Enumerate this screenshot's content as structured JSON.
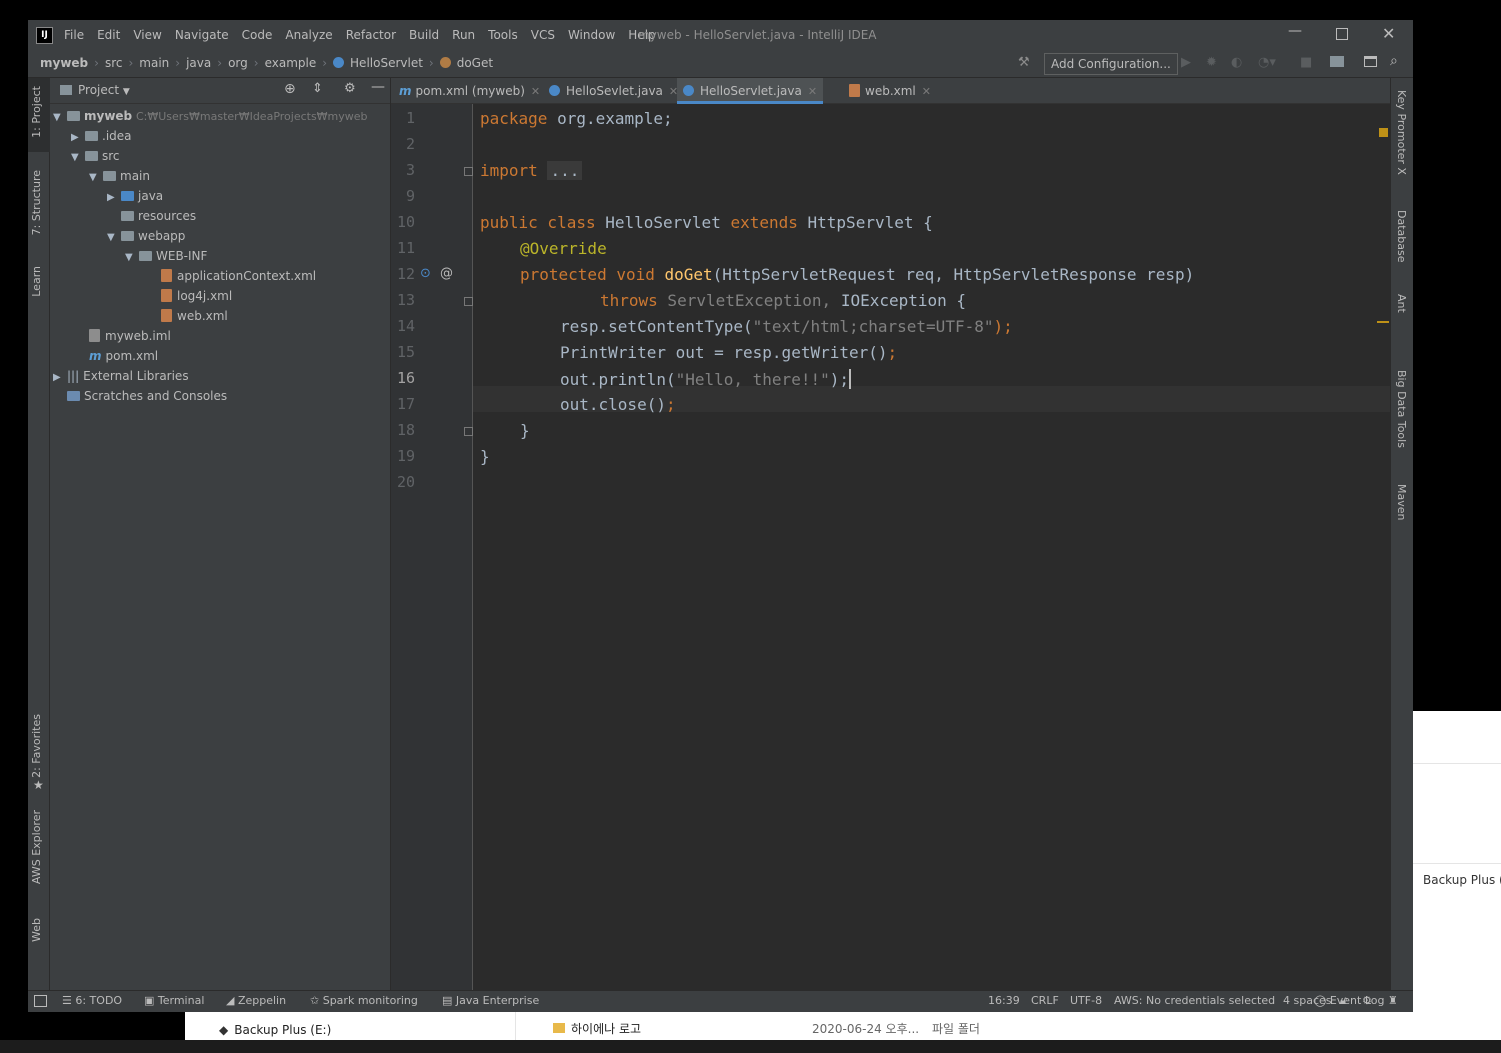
{
  "window": {
    "title": "myweb - HelloServlet.java - IntelliJ IDEA",
    "menu": [
      "File",
      "Edit",
      "View",
      "Navigate",
      "Code",
      "Analyze",
      "Refactor",
      "Build",
      "Run",
      "Tools",
      "VCS",
      "Window",
      "Help"
    ]
  },
  "breadcrumbs": [
    "myweb",
    "src",
    "main",
    "java",
    "org",
    "example",
    "HelloServlet",
    "doGet"
  ],
  "toolbar": {
    "add_configuration": "Add Configuration..."
  },
  "left_strip": {
    "project": "1: Project",
    "structure": "7: Structure",
    "learn": "Learn",
    "favorites": "2: Favorites",
    "aws": "AWS Explorer",
    "web": "Web"
  },
  "right_strip": {
    "key_promoter": "Key Promoter X",
    "database": "Database",
    "ant": "Ant",
    "big_data": "Big Data Tools",
    "maven": "Maven"
  },
  "project": {
    "header": "Project",
    "tree": [
      {
        "label": "myweb",
        "extra": "C:₩Users₩master₩IdeaProjects₩myweb"
      },
      {
        "label": ".idea"
      },
      {
        "label": "src"
      },
      {
        "label": "main"
      },
      {
        "label": "java"
      },
      {
        "label": "resources"
      },
      {
        "label": "webapp"
      },
      {
        "label": "WEB-INF"
      },
      {
        "label": "applicationContext.xml"
      },
      {
        "label": "log4j.xml"
      },
      {
        "label": "web.xml"
      },
      {
        "label": "myweb.iml"
      },
      {
        "label": "pom.xml"
      },
      {
        "label": "External Libraries"
      },
      {
        "label": "Scratches and Consoles"
      }
    ]
  },
  "tabs": [
    {
      "label": "pom.xml (myweb)"
    },
    {
      "label": "HelloSevlet.java"
    },
    {
      "label": "HelloServlet.java"
    },
    {
      "label": "web.xml"
    }
  ],
  "line_numbers": [
    "1",
    "2",
    "3",
    "9",
    "10",
    "11",
    "12",
    "13",
    "14",
    "15",
    "16",
    "17",
    "18",
    "19",
    "20"
  ],
  "code": {
    "l1a": "package",
    "l1b": " org.example;",
    "l3a": "import",
    "l3b": "...",
    "l10a": "public class",
    "l10b": " HelloServlet ",
    "l10c": "extends",
    "l10d": " HttpServlet {",
    "l11": "@Override",
    "l12a": "protected void",
    "l12b": "doGet",
    "l12c": "(HttpServletRequest req, HttpServletResponse resp)",
    "l13a": "throws",
    "l13b": " ServletException,",
    "l13c": " IOException {",
    "l14a": "resp.setContentType(",
    "l14b": "\"text/html;charset=UTF-8\"",
    "l14c": ");",
    "l15a": "PrintWriter out = resp.getWriter()",
    "l15b": ";",
    "l16a": "out.println(",
    "l16b": "\"Hello, there!!\"",
    "l16c": ");",
    "l17a": "out.close()",
    "l17b": ";",
    "l18": "}",
    "l19": "}"
  },
  "bottom_tools": {
    "todo": "6: TODO",
    "terminal": "Terminal",
    "zeppelin": "Zeppelin",
    "spark": "Spark monitoring",
    "java_ee": "Java Enterprise",
    "event_log": "Event Log"
  },
  "status": {
    "position": "16:39",
    "line_sep": "CRLF",
    "encoding": "UTF-8",
    "aws": "AWS: No credentials selected",
    "indent": "4 spaces"
  },
  "background": {
    "backup_right": "Backup Plus (E",
    "backup_left": "Backup Plus (E:)",
    "folder_name": "하이에나 로고",
    "folder_date": "2020-06-24 오후...",
    "folder_type": "파일 폴더"
  }
}
